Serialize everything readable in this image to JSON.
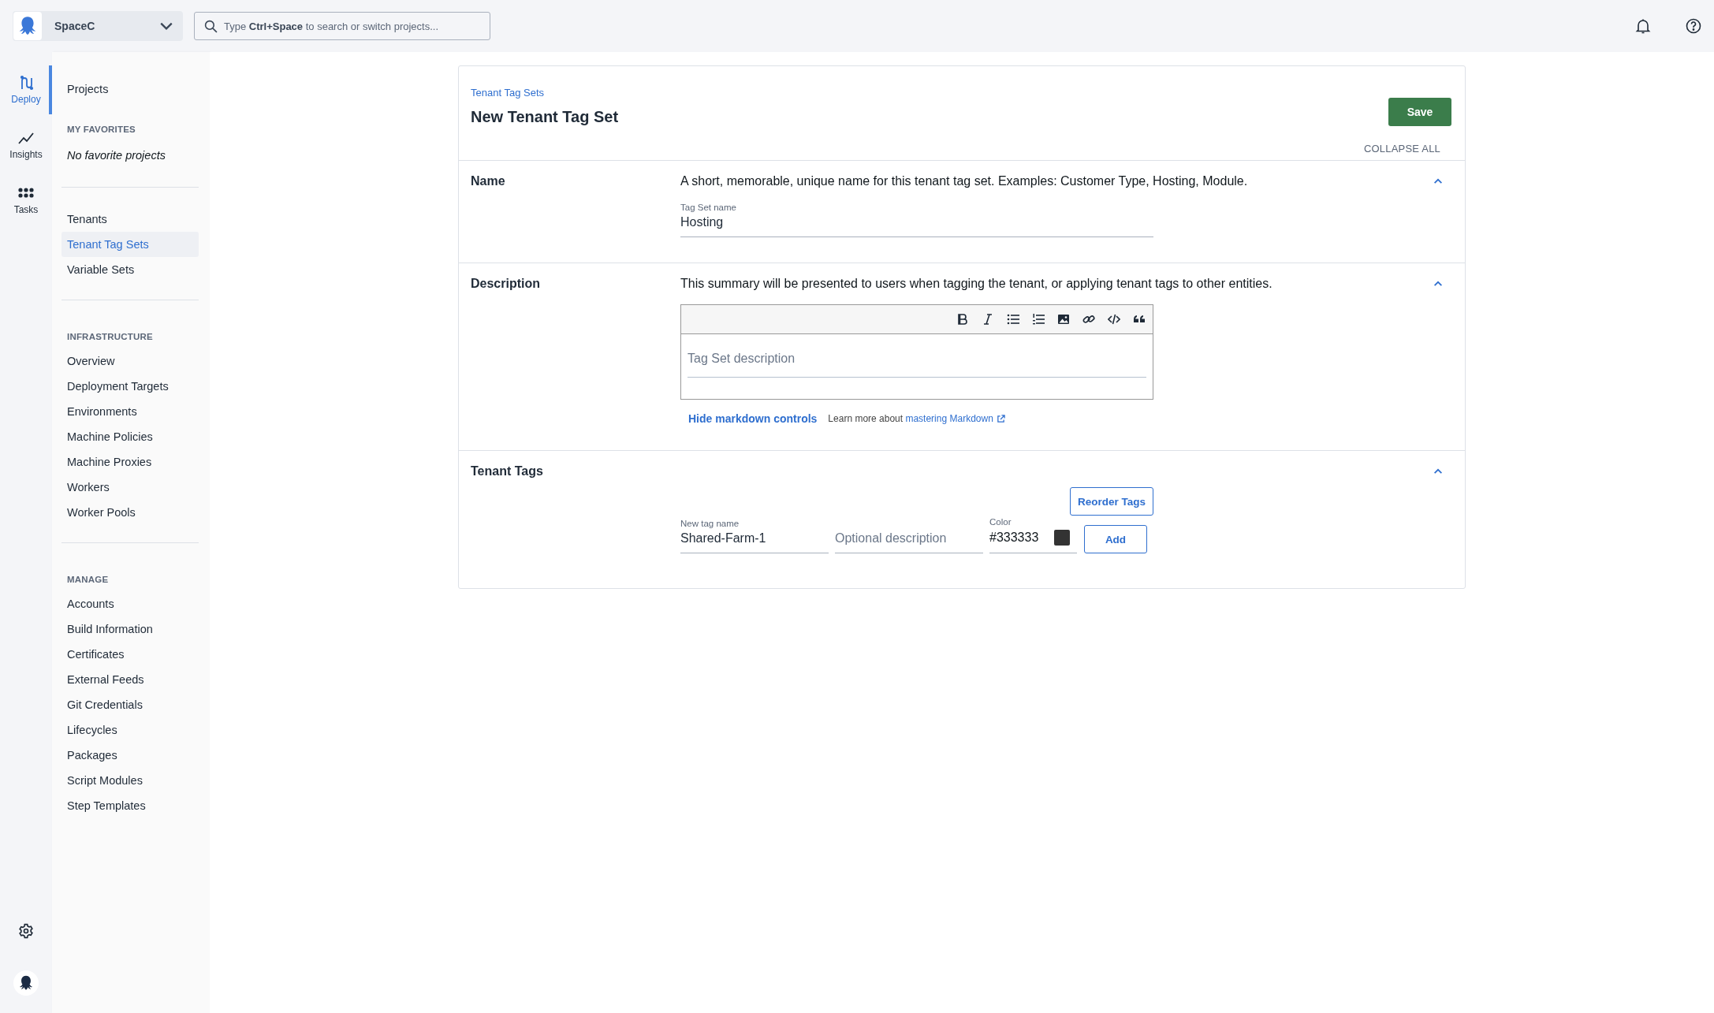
{
  "space": {
    "name": "SpaceC"
  },
  "search": {
    "placeholder": "Type **Ctrl+Space** to search or switch projects..."
  },
  "rail": [
    {
      "label": "Deploy",
      "kind": "deploy",
      "selected": true
    },
    {
      "label": "Insights",
      "kind": "insights",
      "selected": false
    },
    {
      "label": "Tasks",
      "kind": "tasks",
      "selected": false
    }
  ],
  "sidebar": [
    {
      "kind": "link",
      "label": "Projects",
      "selected": false
    },
    {
      "kind": "heading",
      "label": "MY FAVORITES"
    },
    {
      "kind": "note",
      "label": "No favorite projects"
    },
    {
      "kind": "divider"
    },
    {
      "kind": "link",
      "label": "Tenants",
      "selected": false
    },
    {
      "kind": "link",
      "label": "Tenant Tag Sets",
      "selected": true
    },
    {
      "kind": "link",
      "label": "Variable Sets",
      "selected": false
    },
    {
      "kind": "divider"
    },
    {
      "kind": "heading",
      "label": "INFRASTRUCTURE"
    },
    {
      "kind": "link",
      "label": "Overview",
      "selected": false
    },
    {
      "kind": "link",
      "label": "Deployment Targets",
      "selected": false
    },
    {
      "kind": "link",
      "label": "Environments",
      "selected": false
    },
    {
      "kind": "link",
      "label": "Machine Policies",
      "selected": false
    },
    {
      "kind": "link",
      "label": "Machine Proxies",
      "selected": false
    },
    {
      "kind": "link",
      "label": "Workers",
      "selected": false
    },
    {
      "kind": "link",
      "label": "Worker Pools",
      "selected": false
    },
    {
      "kind": "divider"
    },
    {
      "kind": "heading",
      "label": "MANAGE"
    },
    {
      "kind": "link",
      "label": "Accounts",
      "selected": false
    },
    {
      "kind": "link",
      "label": "Build Information",
      "selected": false
    },
    {
      "kind": "link",
      "label": "Certificates",
      "selected": false
    },
    {
      "kind": "link",
      "label": "External Feeds",
      "selected": false
    },
    {
      "kind": "link",
      "label": "Git Credentials",
      "selected": false
    },
    {
      "kind": "link",
      "label": "Lifecycles",
      "selected": false
    },
    {
      "kind": "link",
      "label": "Packages",
      "selected": false
    },
    {
      "kind": "link",
      "label": "Script Modules",
      "selected": false
    },
    {
      "kind": "link",
      "label": "Step Templates",
      "selected": false
    }
  ],
  "page": {
    "breadcrumb": "Tenant Tag Sets",
    "title": "New Tenant Tag Set",
    "save_button": "Save",
    "collapse_all": "COLLAPSE ALL",
    "sections": [
      {
        "kind": "name",
        "title": "Name",
        "expanded": true,
        "help": "A short, memorable, unique name for this tenant tag set. Examples: Customer Type, Hosting, Module.",
        "field": {
          "label": "Tag Set name",
          "value": "Hosting"
        }
      },
      {
        "kind": "description",
        "title": "Description",
        "expanded": true,
        "help": "This summary will be presented to users when tagging the tenant, or applying tenant tags to other entities.",
        "editor": {
          "placeholder": "Tag Set description"
        },
        "hide_link": "Hide markdown controls",
        "learn_more": "Learn more about",
        "learn_link": "mastering Markdown"
      },
      {
        "kind": "tags",
        "title": "Tenant Tags",
        "expanded": true,
        "reorder_button": "Reorder Tags",
        "name_field": {
          "label": "New tag name",
          "value": "Shared-Farm-1"
        },
        "description_field": {
          "placeholder": "Optional description"
        },
        "color_field": {
          "label": "Color",
          "value": "#333333"
        },
        "add_button": "Add"
      }
    ]
  }
}
